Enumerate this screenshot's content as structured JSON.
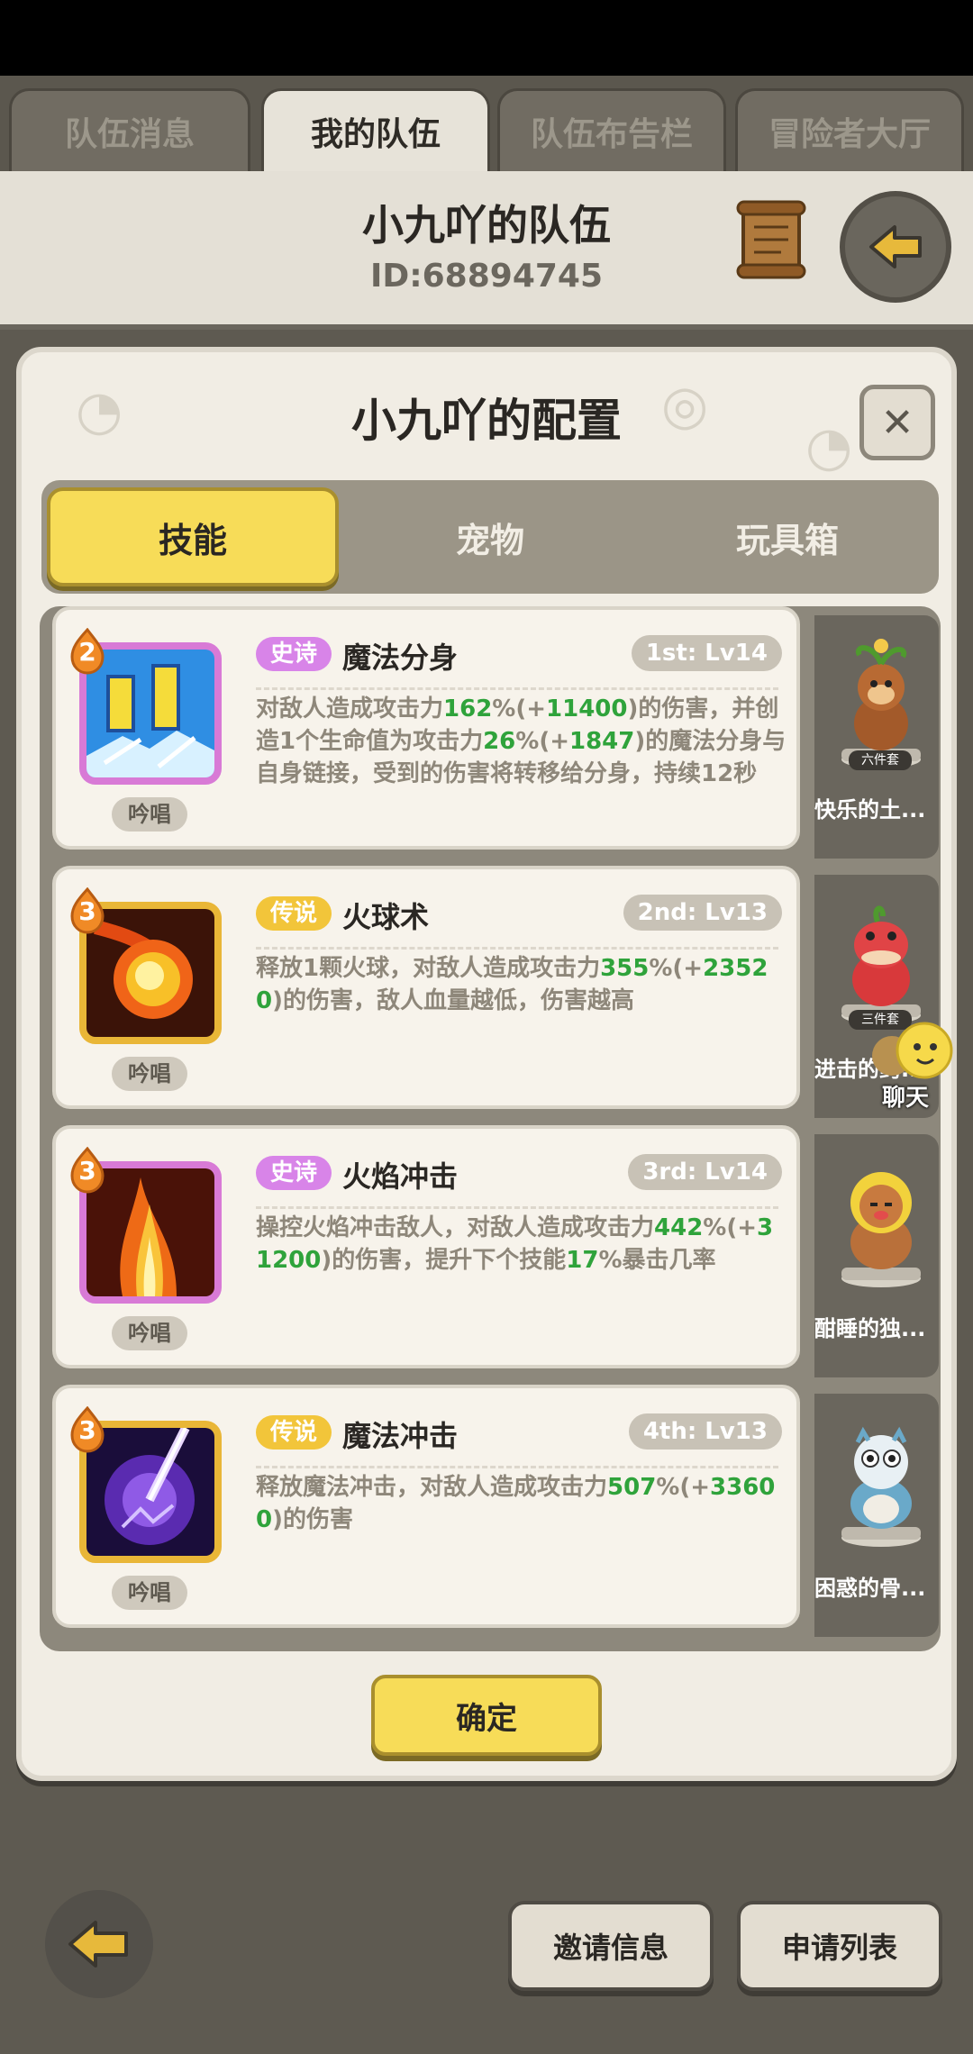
{
  "top_tabs": [
    {
      "label": "队伍消息",
      "active": false
    },
    {
      "label": "我的队伍",
      "active": true
    },
    {
      "label": "队伍布告栏",
      "active": false
    },
    {
      "label": "冒险者大厅",
      "active": false
    }
  ],
  "team": {
    "title": "小九吖的队伍",
    "id": "ID:68894745"
  },
  "panel": {
    "title": "小九吖的配置",
    "close_glyph": "✕",
    "tabs": [
      {
        "label": "技能",
        "active": true
      },
      {
        "label": "宠物",
        "active": false
      },
      {
        "label": "玩具箱",
        "active": false
      }
    ]
  },
  "skills": [
    {
      "level": "2",
      "rarity": "史诗",
      "rarity_type": "epic",
      "name": "魔法分身",
      "rank": "1st: Lv14",
      "cast": "吟唱",
      "desc": [
        {
          "t": "对敌人造成攻击力",
          "c": "n"
        },
        {
          "t": "162",
          "c": "g"
        },
        {
          "t": "%(+",
          "c": "s"
        },
        {
          "t": "11400",
          "c": "g"
        },
        {
          "t": ")的伤害，并创造1个生命值为攻击力",
          "c": "n"
        },
        {
          "t": "26",
          "c": "g"
        },
        {
          "t": "%(+",
          "c": "s"
        },
        {
          "t": "1847",
          "c": "g"
        },
        {
          "t": ")的魔法分身与自身链接，受到的伤害将转移给分身，持续12秒",
          "c": "n"
        }
      ],
      "pet": {
        "name": "快乐的土...",
        "badge": "六件套"
      }
    },
    {
      "level": "3",
      "rarity": "传说",
      "rarity_type": "legend",
      "name": "火球术",
      "rank": "2nd: Lv13",
      "cast": "吟唱",
      "desc": [
        {
          "t": "释放1颗火球，对敌人造成攻击力",
          "c": "n"
        },
        {
          "t": "355",
          "c": "g"
        },
        {
          "t": "%(+",
          "c": "s"
        },
        {
          "t": "23520",
          "c": "g"
        },
        {
          "t": ")的伤害，敌人血量越低，伤害越高",
          "c": "n"
        }
      ],
      "pet": {
        "name": "进击的鳄...",
        "badge": "三件套"
      }
    },
    {
      "level": "3",
      "rarity": "史诗",
      "rarity_type": "epic",
      "name": "火焰冲击",
      "rank": "3rd: Lv14",
      "cast": "吟唱",
      "desc": [
        {
          "t": "操控火焰冲击敌人，对敌人造成攻击力",
          "c": "n"
        },
        {
          "t": "442",
          "c": "g"
        },
        {
          "t": "%(+",
          "c": "s"
        },
        {
          "t": "31200",
          "c": "g"
        },
        {
          "t": ")的伤害，提升下个技能",
          "c": "n"
        },
        {
          "t": "17",
          "c": "g"
        },
        {
          "t": "%暴击几率",
          "c": "n"
        }
      ],
      "pet": {
        "name": "酣睡的独...",
        "badge": ""
      }
    },
    {
      "level": "3",
      "rarity": "传说",
      "rarity_type": "legend",
      "name": "魔法冲击",
      "rank": "4th: Lv13",
      "cast": "吟唱",
      "desc": [
        {
          "t": "释放魔法冲击，对敌人造成攻击力",
          "c": "n"
        },
        {
          "t": "507",
          "c": "g"
        },
        {
          "t": "%(+",
          "c": "s"
        },
        {
          "t": "33600",
          "c": "g"
        },
        {
          "t": ")的伤害",
          "c": "n"
        }
      ],
      "pet": {
        "name": "困惑的骨...",
        "badge": ""
      }
    }
  ],
  "confirm_label": "确定",
  "chat_label": "聊天",
  "bottom": {
    "invite_label": "邀请信息",
    "apply_label": "申请列表"
  },
  "icons": {
    "skill_1": "magic-clone-icon",
    "skill_2": "fireball-icon",
    "skill_3": "flame-strike-icon",
    "skill_4": "magic-strike-icon",
    "pet_1": "monkey-pet-icon",
    "pet_2": "crocodile-pet-icon",
    "pet_3": "lion-pet-icon",
    "pet_4": "dragon-pet-icon"
  },
  "colors": {
    "accent_yellow": "#f7dc58",
    "number_green": "#2fa33b",
    "epic_pink": "#d884e8",
    "legend_gold": "#f2c53a"
  }
}
